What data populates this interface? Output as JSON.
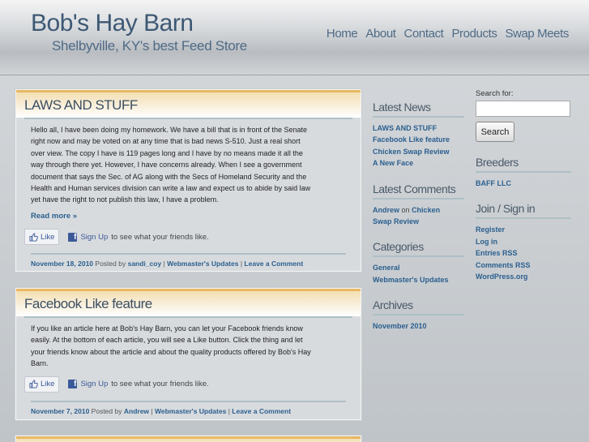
{
  "header": {
    "site_title": "Bob's Hay Barn",
    "site_description": "Shelbyville, KY's best Feed Store",
    "nav": [
      "Home",
      "About",
      "Contact",
      "Products",
      "Swap Meets"
    ]
  },
  "posts": [
    {
      "title": "LAWS AND STUFF",
      "paragraphs": [
        "Hello all, I have been doing my homework.  We have a bill that is in front of the Senate",
        "right now and may be voted on at  any time  that is bad news S-510.  Just a real short",
        "over view.  The copy I have is 119 pages long and I have by no means made it all the",
        "way through there yet.   However, I have concerns already.  When I see a government",
        "document that says the Sec. of AG along with the Secs of Homeland Security and the",
        "Health and Human services division can write a law and expect us to abide by said law",
        "yet have the right to not publish this law, I have a problem."
      ],
      "read_more": "Read more »",
      "like_label": "Like",
      "signup_link": "Sign Up",
      "signup_text": "to see what your friends like.",
      "date": "November 18, 2010",
      "posted_by": "Posted by",
      "author": "sandi_coy",
      "sep": "|",
      "category": "Webmaster's Updates",
      "comment_link": "Leave a Comment"
    },
    {
      "title": "Facebook Like feature",
      "paragraphs": [
        "If you like an article here at Bob's Hay Barn, you can let your Facebook friends know",
        "easily.  At the bottom of each article, you will see a Like button.  Click the thing and let",
        "your friends know about the article and about the quality products offered by Bob's Hay",
        "Barn."
      ],
      "like_label": "Like",
      "signup_link": "Sign Up",
      "signup_text": "to see what your friends like.",
      "date": "November 7, 2010",
      "posted_by": "Posted by",
      "author": "Andrew",
      "sep": "|",
      "category": "Webmaster's Updates",
      "comment_link": "Leave a Comment"
    }
  ],
  "sidebar_left": {
    "latest_news": {
      "title": "Latest News",
      "items": [
        "LAWS AND STUFF",
        "Facebook Like feature",
        "Chicken Swap Review",
        "A New Face"
      ]
    },
    "latest_comments": {
      "title": "Latest Comments",
      "author": "Andrew",
      "on": "on",
      "post": "Chicken",
      "post_cont": "Swap Review"
    },
    "categories": {
      "title": "Categories",
      "items": [
        "General",
        "Webmaster's Updates"
      ]
    },
    "archives": {
      "title": "Archives",
      "items": [
        "November 2010"
      ]
    }
  },
  "sidebar_right": {
    "search": {
      "label": "Search for:",
      "value": "",
      "button": "Search"
    },
    "breeders": {
      "title": "Breeders",
      "items": [
        "BAFF LLC"
      ]
    },
    "join": {
      "title": "Join / Sign in",
      "items": [
        "Register",
        "Log in",
        "Entries RSS",
        "Comments RSS",
        "WordPress.org"
      ]
    }
  }
}
